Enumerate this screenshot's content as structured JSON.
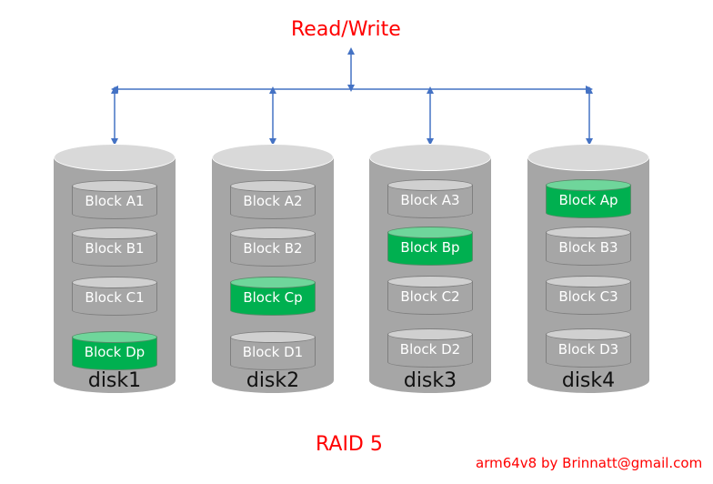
{
  "header": {
    "label": "Read/Write"
  },
  "footer": {
    "title": "RAID 5",
    "credit": "arm64v8 by Brinnatt@gmail.com"
  },
  "colors": {
    "accent": "#ff0000",
    "arrow": "#4472c4",
    "parity": "#00b050",
    "disk": "#a6a6a6"
  },
  "disks": [
    {
      "name": "disk1",
      "blocks": [
        {
          "label": "Block A1",
          "parity": false
        },
        {
          "label": "Block B1",
          "parity": false
        },
        {
          "label": "Block C1",
          "parity": false
        },
        {
          "label": "Block Dp",
          "parity": true
        }
      ]
    },
    {
      "name": "disk2",
      "blocks": [
        {
          "label": "Block A2",
          "parity": false
        },
        {
          "label": "Block B2",
          "parity": false
        },
        {
          "label": "Block Cp",
          "parity": true
        },
        {
          "label": "Block D1",
          "parity": false
        }
      ]
    },
    {
      "name": "disk3",
      "blocks": [
        {
          "label": "Block A3",
          "parity": false
        },
        {
          "label": "Block Bp",
          "parity": true
        },
        {
          "label": "Block C2",
          "parity": false
        },
        {
          "label": "Block D2",
          "parity": false
        }
      ]
    },
    {
      "name": "disk4",
      "blocks": [
        {
          "label": "Block Ap",
          "parity": true
        },
        {
          "label": "Block B3",
          "parity": false
        },
        {
          "label": "Block C3",
          "parity": false
        },
        {
          "label": "Block D3",
          "parity": false
        }
      ]
    }
  ]
}
